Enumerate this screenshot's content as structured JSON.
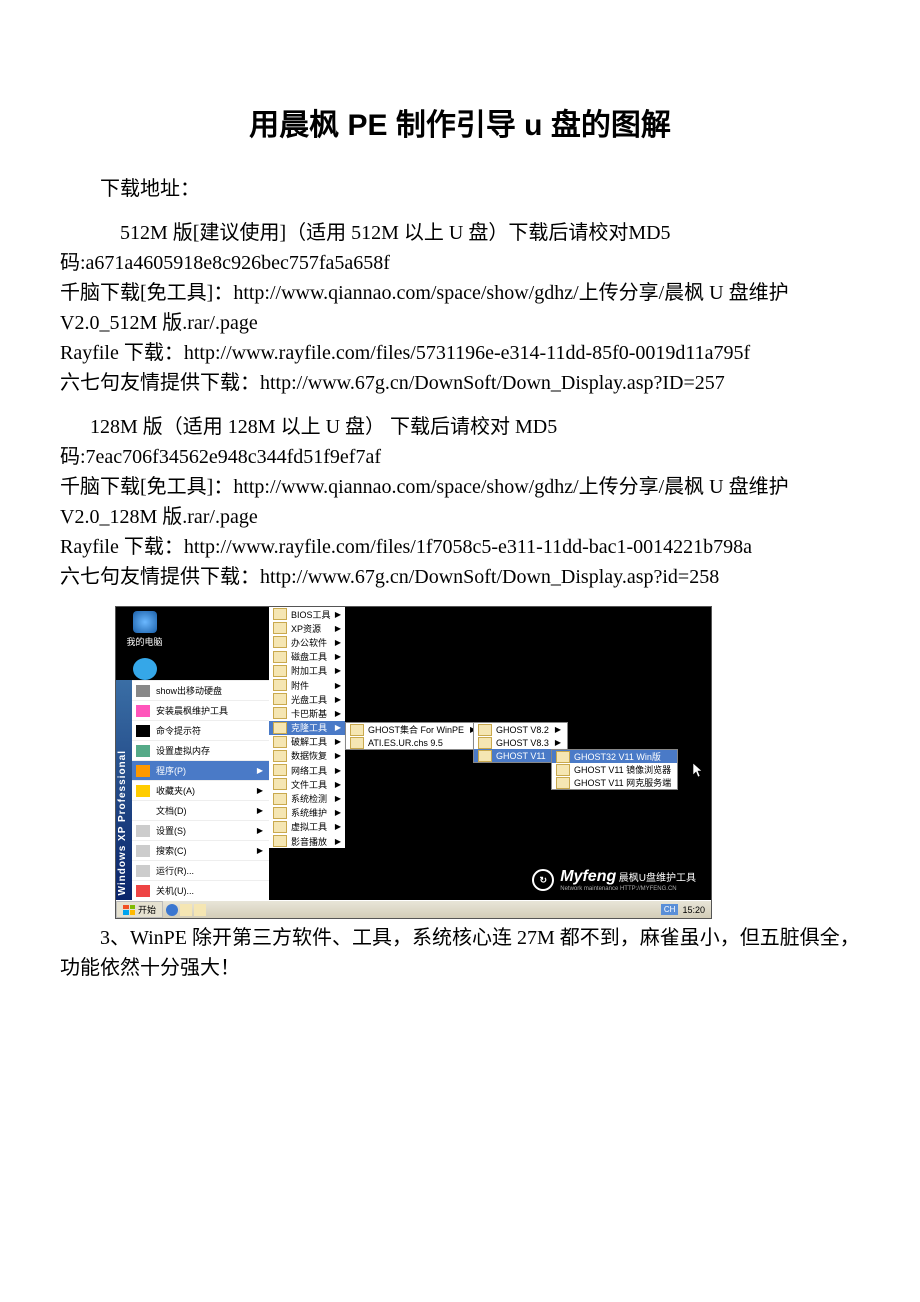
{
  "title": "用晨枫 PE 制作引导 u 盘的图解",
  "para1": "下载地址：",
  "para2": "512M 版[建议使用]（适用 512M 以上 U 盘）下载后请校对MD5 码:a671a4605918e8c926bec757fa5a658f",
  "para2b": "千脑下载[免工具]：http://www.qiannao.com/space/show/gdhz/上传分享/晨枫 U 盘维护 V2.0_512M 版.rar/.page",
  "para2c": "Rayfile 下载：http://www.rayfile.com/files/5731196e-e314-11dd-85f0-0019d11a795f",
  "para2d": "六七句友情提供下载：http://www.67g.cn/DownSoft/Down_Display.asp?ID=257",
  "para3": "128M 版（适用 128M 以上 U 盘） 下载后请校对 MD5 码:7eac706f34562e948c344fd51f9ef7af",
  "para3b": "千脑下载[免工具]：http://www.qiannao.com/space/show/gdhz/上传分享/晨枫 U 盘维护 V2.0_128M 版.rar/.page",
  "para3c": "Rayfile 下载：http://www.rayfile.com/files/1f7058c5-e311-11dd-bac1-0014221b798a",
  "para3d": "六七句友情提供下载：http://www.67g.cn/DownSoft/Down_Display.asp?id=258",
  "para4": "3、WinPE 除开第三方软件、工具，系统核心连 27M 都不到，麻雀虽小，但五脏俱全，功能依然十分强大！",
  "screenshot": {
    "desktop_icons": [
      "我的电脑",
      "网上邻居"
    ],
    "start_items": [
      {
        "label": "show出移动硬盘",
        "arrow": false
      },
      {
        "label": "安装晨枫维护工具",
        "arrow": false
      },
      {
        "label": "命令提示符",
        "arrow": false
      },
      {
        "label": "设置虚拟内存",
        "arrow": false
      },
      {
        "label": "程序(P)",
        "arrow": true,
        "hl": true
      },
      {
        "label": "收藏夹(A)",
        "arrow": true
      },
      {
        "label": "文档(D)",
        "arrow": true
      },
      {
        "label": "设置(S)",
        "arrow": true
      },
      {
        "label": "搜索(C)",
        "arrow": true
      },
      {
        "label": "运行(R)...",
        "arrow": false
      },
      {
        "label": "关机(U)...",
        "arrow": false
      }
    ],
    "menu2": [
      "BIOS工具",
      "XP资源",
      "办公软件",
      "磁盘工具",
      "附加工具",
      "附件",
      "光盘工具",
      "卡巴斯基",
      "克隆工具",
      "破解工具",
      "数据恢复",
      "网络工具",
      "文件工具",
      "系统检测",
      "系统维护",
      "虚拟工具",
      "影音播放"
    ],
    "menu2_hl_index": 8,
    "menu3": [
      {
        "label": "GHOST集合 For WinPE",
        "arrow": true,
        "hl": false
      },
      {
        "label": "ATI.ES.UR.chs 9.5",
        "arrow": false,
        "hl": false
      }
    ],
    "menu4": [
      {
        "label": "GHOST V8.2",
        "arrow": true
      },
      {
        "label": "GHOST V8.3",
        "arrow": true
      },
      {
        "label": "GHOST V11",
        "arrow": true,
        "hl": true
      }
    ],
    "menu5": [
      {
        "label": "GHOST32 V11 Win版",
        "hl": true
      },
      {
        "label": "GHOST V11 镜像浏览器",
        "hl": false
      },
      {
        "label": "GHOST V11 网克服务端",
        "hl": false
      }
    ],
    "myfeng_big": "Myfeng",
    "myfeng_cn": "晨枫U盘维护工具",
    "myfeng_sub": "Network maintenance    HTTP://MYFENG.CN",
    "taskbar_start": "开始",
    "taskbar_lang": "CH",
    "taskbar_time": "15:20",
    "strip_label": "Windows XP Professional"
  }
}
